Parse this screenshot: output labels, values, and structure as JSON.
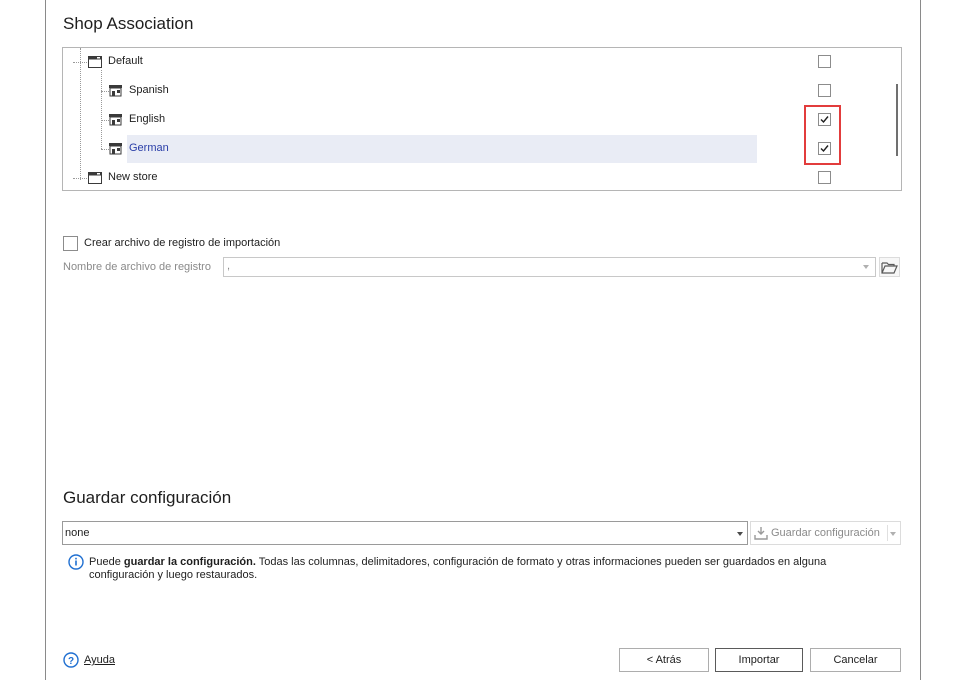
{
  "shop_association": {
    "title": "Shop Association",
    "tree": [
      {
        "label": "Default",
        "level": 0,
        "checked": false
      },
      {
        "label": "Spanish",
        "level": 1,
        "checked": false
      },
      {
        "label": "English",
        "level": 1,
        "checked": true
      },
      {
        "label": "German",
        "level": 1,
        "checked": true,
        "selected": true
      },
      {
        "label": "New store",
        "level": 0,
        "checked": false
      }
    ]
  },
  "log": {
    "create_label": "Crear archivo de registro de importación",
    "create_checked": false,
    "filename_label": "Nombre de archivo de registro",
    "filename_value": ","
  },
  "save_config": {
    "title": "Guardar configuración",
    "select_value": "none",
    "save_button_label": "Guardar configuración",
    "info_prefix": "Puede ",
    "info_bold": "guardar la configuración.",
    "info_rest": " Todas las columnas, delimitadores, configuración de formato y otras informaciones pueden ser guardados en alguna",
    "info_line2": "configuración y luego restaurados."
  },
  "footer": {
    "help_label": "Ayuda",
    "back_label": "< Atrás",
    "import_label": "Importar",
    "cancel_label": "Cancelar"
  },
  "icons": {
    "store": "store-window-icon",
    "shop": "shop-icon",
    "folder": "folder-open-icon",
    "info": "info-icon",
    "help": "help-icon",
    "save": "download-save-icon"
  },
  "colors": {
    "highlight_border": "#e23c3c",
    "selected_text": "#2a3ea8",
    "info_blue": "#1f6fd1"
  }
}
